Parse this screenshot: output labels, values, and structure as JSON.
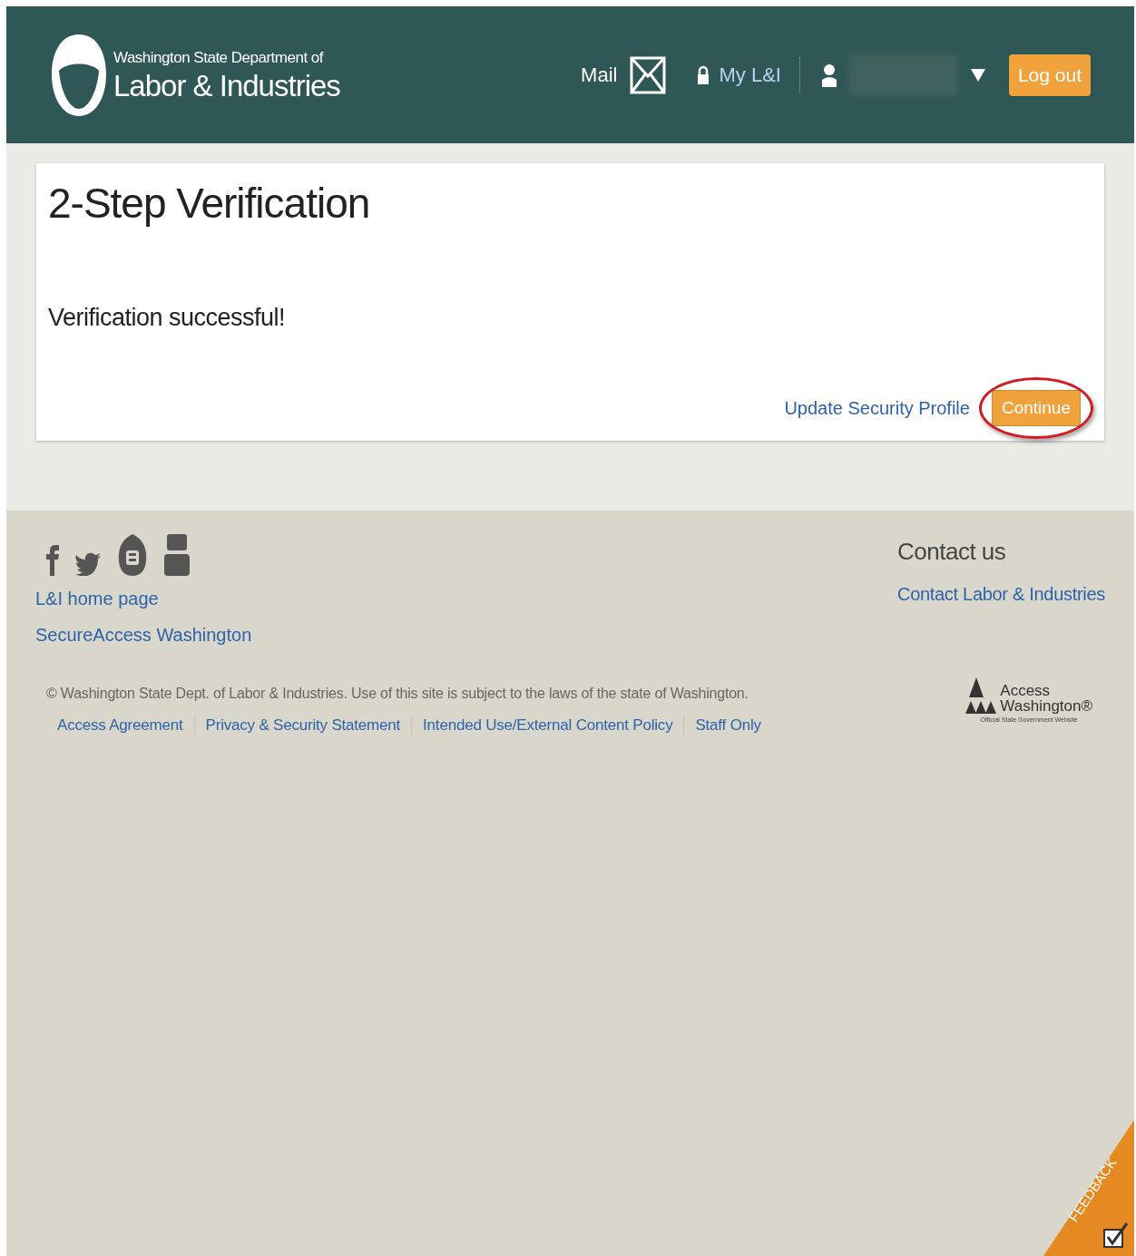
{
  "header": {
    "logo": {
      "line_1": "Washington State Department of",
      "line_2": "Labor & Industries"
    },
    "mail": "Mail",
    "my_account": "My L&I",
    "log_out": "Log out"
  },
  "card": {
    "title": "2-Step Verification",
    "message": "Verification successful!",
    "link": "Update Security Profile",
    "button": "Continue",
    "button_circled": true
  },
  "footer": {
    "links": [
      "L&I home page",
      "SecureAccess Washington"
    ],
    "contact": {
      "heading": "Contact us",
      "link": "Contact Labor & Industries"
    },
    "copyright": "© Washington State Dept. of Labor & Industries. Use of this site is subject to the laws of the state of Washington.",
    "legal_links": [
      "Access Agreement",
      "Privacy & Security Statement",
      "Intended Use/External Content Policy",
      "Staff Only"
    ],
    "badge": {
      "line_1": "Access",
      "line_2": "Washington®",
      "line_3": "Official State Government Website"
    }
  },
  "feedback": "FEEDBACK"
}
